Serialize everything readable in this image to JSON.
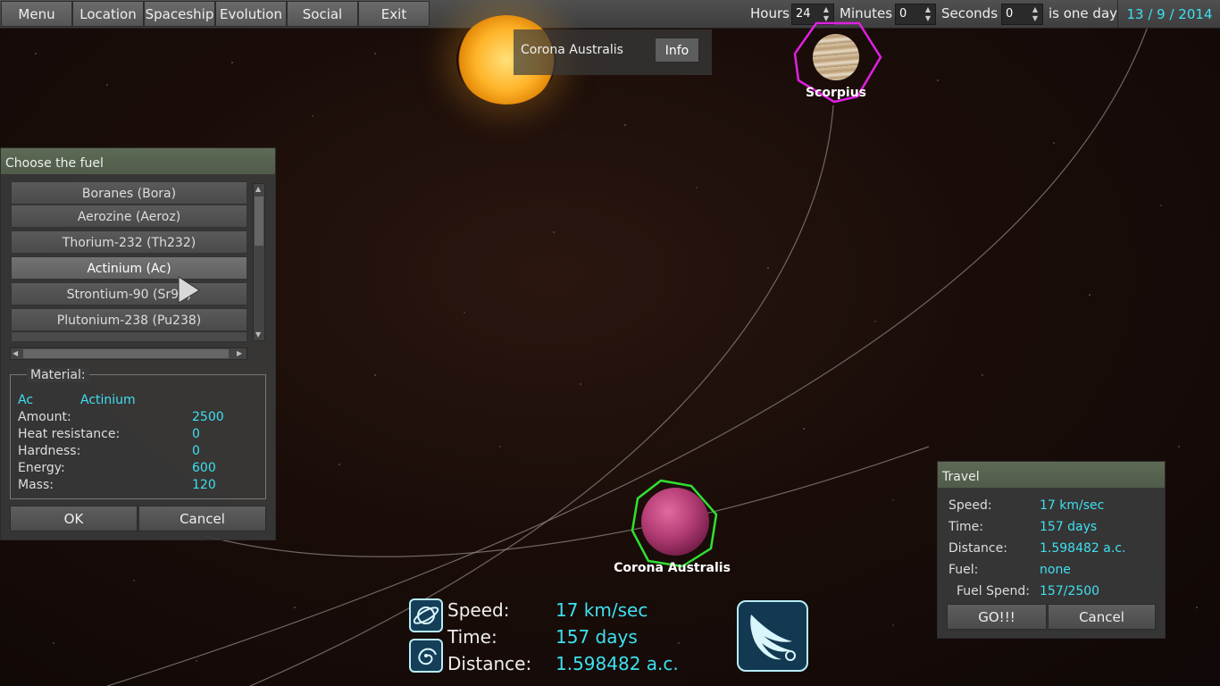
{
  "menu": {
    "items": [
      "Menu",
      "Location",
      "Spaceship",
      "Evolution",
      "Social",
      "Exit"
    ]
  },
  "time": {
    "hours_label": "Hours",
    "hours_value": "24",
    "minutes_label": "Minutes",
    "minutes_value": "0",
    "seconds_label": "Seconds",
    "seconds_value": "0",
    "suffix": "is one day",
    "date": "13 / 9 / 2014"
  },
  "map": {
    "tooltip_label": "Corona Australis",
    "info_button": "Info",
    "planet_scorpius": "Scorpius",
    "planet_corona": "Corona Australis"
  },
  "fuel_dialog": {
    "title": "Choose the fuel",
    "items": [
      "Boranes (Bora)",
      "Aerozine (Aeroz)",
      "Thorium-232 (Th232)",
      "Actinium (Ac)",
      "Strontium-90 (Sr90)",
      "Plutonium-238 (Pu238)"
    ],
    "selected_item": "Actinium (Ac)",
    "material_legend": "Material:",
    "material_symbol": "Ac",
    "material_name": "Actinium",
    "rows": [
      {
        "label": "Amount:",
        "value": "2500"
      },
      {
        "label": "Heat resistance:",
        "value": "0"
      },
      {
        "label": "Hardness:",
        "value": "0"
      },
      {
        "label": "Energy:",
        "value": "600"
      },
      {
        "label": "Mass:",
        "value": "120"
      }
    ],
    "ok_button": "OK",
    "cancel_button": "Cancel"
  },
  "travel_panel": {
    "title": "Travel",
    "rows": [
      {
        "label": "Speed:",
        "value": "17 km/sec"
      },
      {
        "label": "Time:",
        "value": "157 days"
      },
      {
        "label": "Distance:",
        "value": "1.598482 a.c."
      },
      {
        "label": "Fuel:",
        "value": "none"
      },
      {
        "label": "Fuel Spend:",
        "value": "157/2500"
      }
    ],
    "go_button": "GO!!!",
    "cancel_button": "Cancel"
  },
  "hud": {
    "speed_label": "Speed:",
    "speed_value": "17 km/sec",
    "time_label": "Time:",
    "time_value": "157 days",
    "distance_label": "Distance:",
    "distance_value": "1.598482 a.c."
  },
  "colors": {
    "accent": "#3ee0f0",
    "scorpius_marker": "#e020e0",
    "corona_marker": "#30e030"
  },
  "icons": [
    "planet-icon",
    "galaxy-icon",
    "wing-icon",
    "up-arrow-icon",
    "down-arrow-icon",
    "cursor-icon"
  ]
}
